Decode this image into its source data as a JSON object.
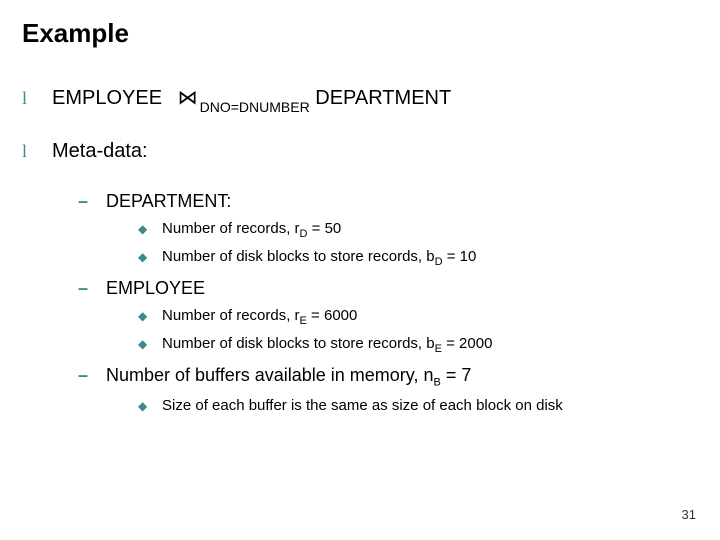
{
  "title": "Example",
  "line1": {
    "left_rel": "EMPLOYEE",
    "join_symbol": "⋈",
    "join_cond": "DNO=DNUMBER",
    "right_rel": "DEPARTMENT"
  },
  "line2": "Meta-data:",
  "dept": {
    "label": "DEPARTMENT:",
    "rec": {
      "prefix": "Number of records, r",
      "sub": "D",
      "suffix": " = 50"
    },
    "blk": {
      "prefix": "Number of disk blocks to store records, b",
      "sub": "D",
      "suffix": " = 10"
    }
  },
  "emp": {
    "label": "EMPLOYEE",
    "rec": {
      "prefix": "Number of records, r",
      "sub": "E",
      "suffix": " = 6000"
    },
    "blk": {
      "prefix": "Number of disk blocks to store records, b",
      "sub": "E",
      "suffix": " = 2000"
    }
  },
  "buf": {
    "prefix": "Number of buffers available in memory, n",
    "sub": "B",
    "suffix": " = 7",
    "note": "Size of each buffer is the same as size of each block on disk"
  },
  "page_number": "31"
}
